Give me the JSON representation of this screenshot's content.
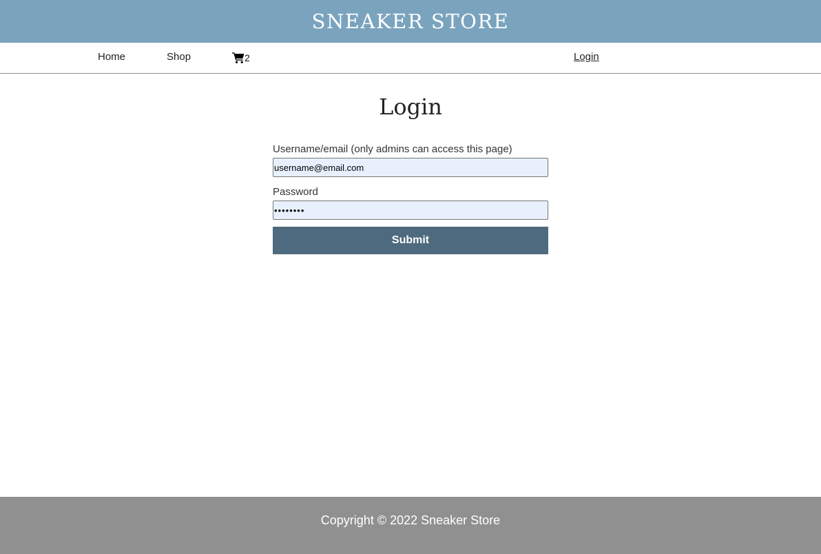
{
  "header": {
    "title": "SNEAKER STORE"
  },
  "nav": {
    "home": "Home",
    "shop": "Shop",
    "cart_count": "2",
    "login": "Login",
    "cart_icon": "shopping-cart-icon"
  },
  "main": {
    "title": "Login",
    "username_label": "Username/email (only admins can access this page)",
    "username_value": "username@email.com",
    "password_label": "Password",
    "password_value": "••••••••",
    "submit_label": "Submit"
  },
  "footer": {
    "text": "Copyright © 2022 Sneaker Store"
  },
  "colors": {
    "header_bg": "#7aa3be",
    "button_bg": "#4e6a7e",
    "footer_bg": "#909090",
    "input_bg": "#e8f0fe"
  }
}
